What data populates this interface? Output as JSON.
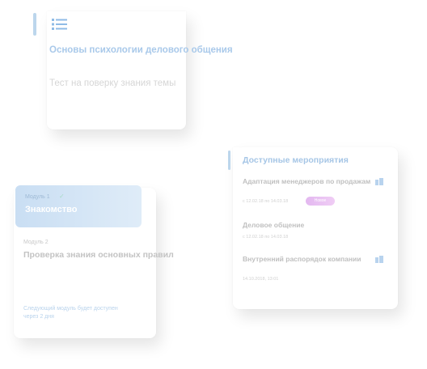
{
  "course": {
    "title": "Основы психологии делового общения",
    "test_text": "Тест на поверку знания темы"
  },
  "modules": {
    "module1": {
      "label": "Модуль 1",
      "check": "✓",
      "name": "Знакомство"
    },
    "module2": {
      "label": "Модуль 2",
      "name": "Проверка знания основных правил"
    },
    "next_note": "Следующий модуль будет доступен через 2 дня"
  },
  "events": {
    "title": "Доступные мероприятия",
    "items": [
      {
        "name": "Адаптация менеджеров по продажам",
        "date": "с 12.02.18 по 14.03.18",
        "badge": "Новое",
        "icon": "building-icon"
      },
      {
        "name": "Деловое общение",
        "date": "с 12.02.18 по 14.03.18"
      },
      {
        "name": "Внутренний распорядок компании",
        "date": "14.10.2018, 13:01",
        "icon": "building-icon"
      }
    ]
  },
  "colors": {
    "accent": "#a9c9ea",
    "module_active": "#c9def3",
    "badge": "#e3b8f0"
  }
}
